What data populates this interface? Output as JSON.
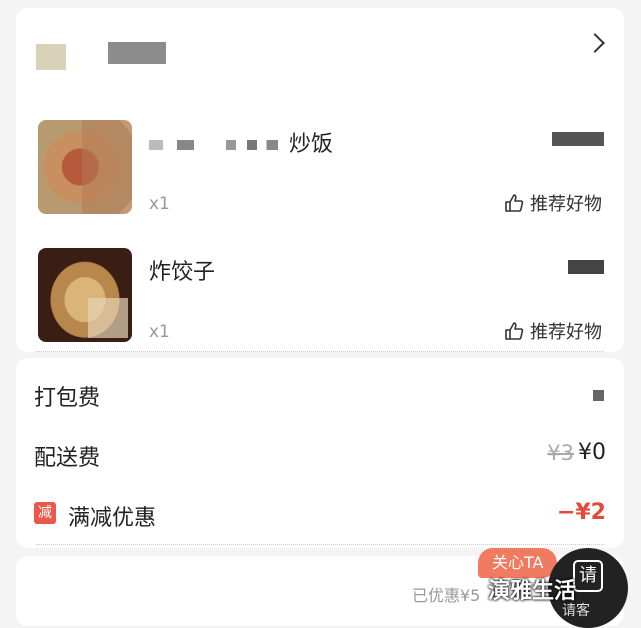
{
  "order": {
    "items": [
      {
        "name_suffix": "炒饭",
        "quantity": "x1",
        "recommend_label": "推荐好物"
      },
      {
        "name": "炸饺子",
        "quantity": "x1",
        "recommend_label": "推荐好物"
      }
    ]
  },
  "fees": {
    "packing": {
      "label": "打包费"
    },
    "delivery": {
      "label": "配送费",
      "original": "¥3",
      "value": "¥0"
    },
    "discount": {
      "tag": "减",
      "label": "满减优惠",
      "value": "−¥2"
    }
  },
  "bottom": {
    "savings_text": "已优惠¥5",
    "care_badge": "关心TA",
    "fab_char": "请",
    "fab_sub": "请客"
  },
  "watermark": "演雅生活",
  "colors": {
    "accent_red": "#e34a3c",
    "badge": "#f07b61",
    "tag_red": "#e9584a"
  }
}
